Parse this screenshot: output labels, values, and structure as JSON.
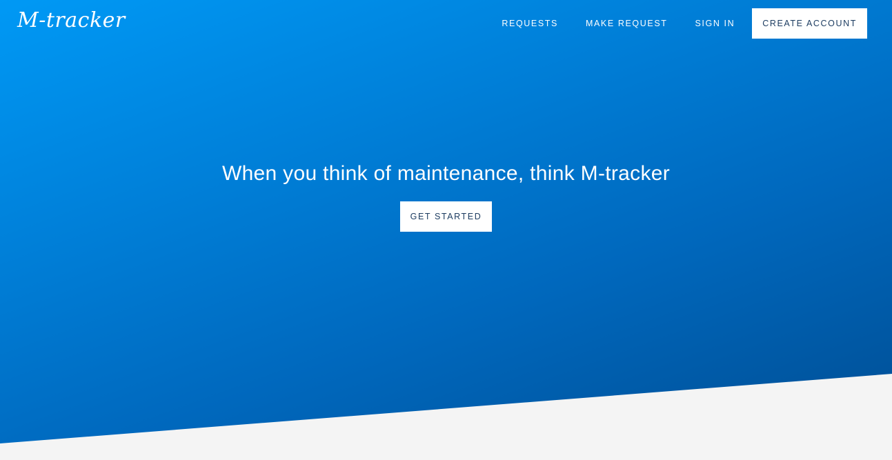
{
  "brand": {
    "logo_text": "M-tracker"
  },
  "nav": {
    "items": [
      {
        "label": "REQUESTS"
      },
      {
        "label": "MAKE REQUEST"
      },
      {
        "label": "SIGN IN"
      }
    ],
    "cta_label": "CREATE ACCOUNT"
  },
  "hero": {
    "tagline": "When you think of maintenance, think M-tracker",
    "button_label": "GET STARTED"
  },
  "colors": {
    "gradient_start": "#0099f5",
    "gradient_end": "#004c91",
    "button_background": "#ffffff",
    "button_text": "#1a3a5f",
    "page_background": "#f4f4f4"
  }
}
